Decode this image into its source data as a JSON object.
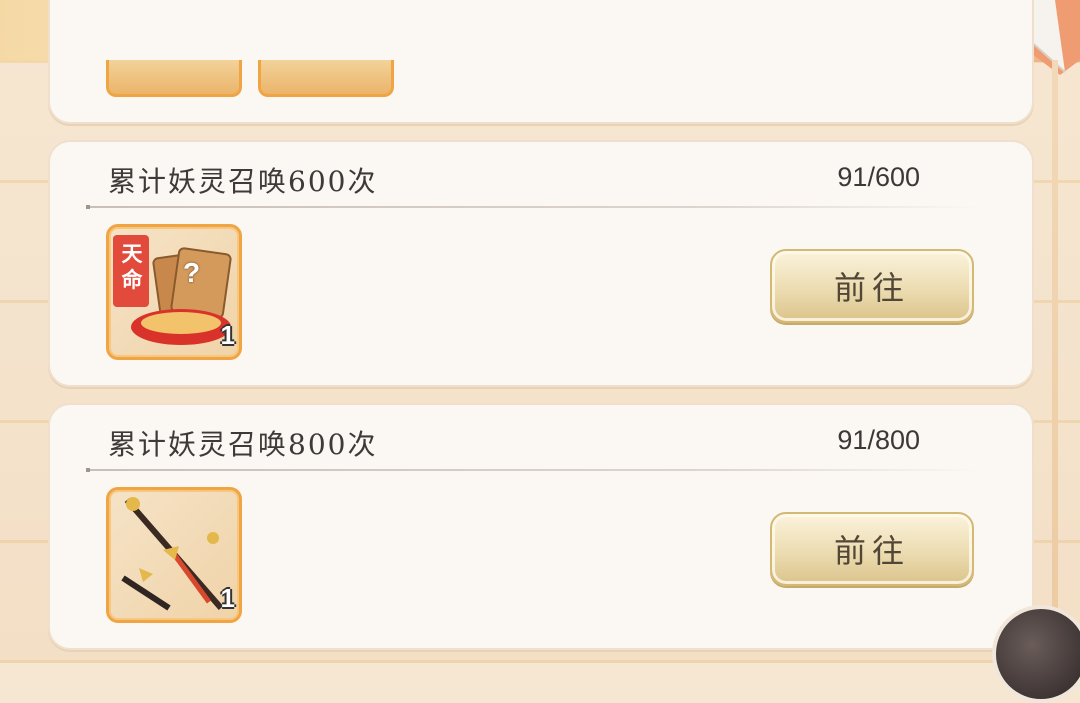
{
  "tasks": [
    {
      "title": "累计妖灵召唤600次",
      "progress": "91/600",
      "reward": {
        "name": "天命",
        "icon": "fate-card-icon",
        "count": "1"
      },
      "button_label": "前往"
    },
    {
      "title": "累计妖灵召唤800次",
      "progress": "91/800",
      "reward": {
        "icon": "crossed-swords-icon",
        "count": "1"
      },
      "button_label": "前往"
    }
  ],
  "colors": {
    "frame_orange": "#f0a443",
    "card_bg": "#fbf7f2",
    "text": "#3d3a3a",
    "seal_red": "#e24a3b"
  }
}
